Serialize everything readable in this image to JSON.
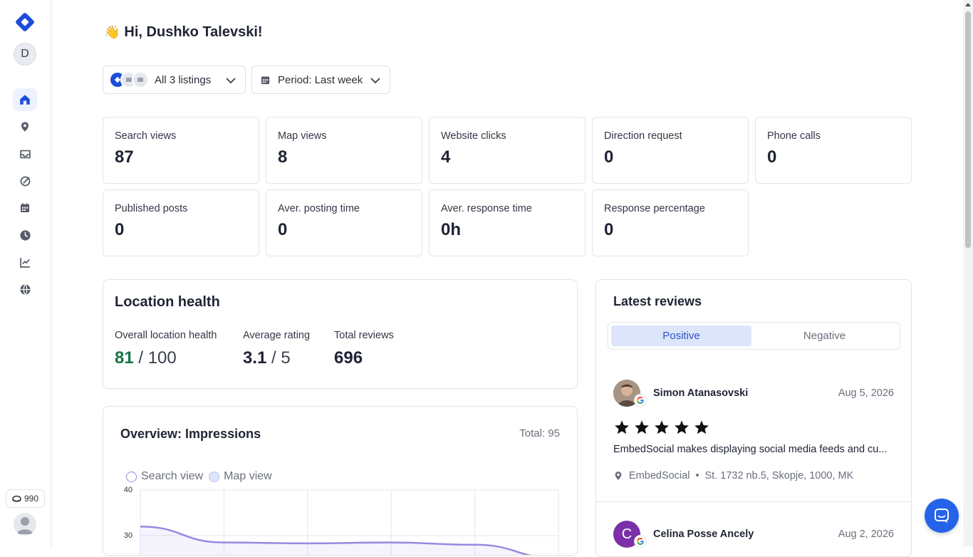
{
  "sidebar": {
    "avatar_initial": "D",
    "credits": "990",
    "items": [
      {
        "icon": "home-icon",
        "active": true
      },
      {
        "icon": "location-pin-icon",
        "active": false
      },
      {
        "icon": "inbox-icon",
        "active": false
      },
      {
        "icon": "posts-icon",
        "active": false
      },
      {
        "icon": "calendar-icon",
        "active": false
      },
      {
        "icon": "clock-icon",
        "active": false
      },
      {
        "icon": "analytics-icon",
        "active": false
      },
      {
        "icon": "globe-icon",
        "active": false
      }
    ]
  },
  "header": {
    "wave": "👋",
    "greeting": "Hi, Dushko Talevski!"
  },
  "filters": {
    "listings": "All 3 listings",
    "period": "Period: Last week"
  },
  "stats": [
    {
      "label": "Search views",
      "value": "87"
    },
    {
      "label": "Map views",
      "value": "8"
    },
    {
      "label": "Website clicks",
      "value": "4"
    },
    {
      "label": "Direction request",
      "value": "0"
    },
    {
      "label": "Phone calls",
      "value": "0"
    },
    {
      "label": "Published posts",
      "value": "0"
    },
    {
      "label": "Aver. posting time",
      "value": "0"
    },
    {
      "label": "Aver. response time",
      "value": "0h"
    },
    {
      "label": "Response percentage",
      "value": "0"
    }
  ],
  "health": {
    "title": "Location health",
    "overall_label": "Overall location health",
    "overall_value": "81",
    "overall_max": "/ 100",
    "rating_label": "Average rating",
    "rating_value": "3.1",
    "rating_max": "/ 5",
    "reviews_label": "Total reviews",
    "reviews_value": "696"
  },
  "overview": {
    "title": "Overview: Impressions",
    "total": "Total: 95",
    "legend": [
      "Search view",
      "Map view"
    ],
    "colors": {
      "search": "#9b87e0",
      "map": "#b7c4f2"
    }
  },
  "chart_data": {
    "type": "line",
    "series": [
      {
        "name": "Search view",
        "values": [
          32,
          28.5,
          28.3,
          28.5,
          28,
          25
        ]
      },
      {
        "name": "Map view",
        "values": []
      }
    ],
    "y_ticks": [
      "40",
      "30"
    ],
    "ylim": [
      0,
      40
    ]
  },
  "reviews": {
    "title": "Latest reviews",
    "tab_positive": "Positive",
    "tab_negative": "Negative",
    "items": [
      {
        "name": "Simon Atanasovski",
        "date": "Aug 5, 2026",
        "stars": 5,
        "text": "EmbedSocial makes displaying social media feeds and cu...",
        "business": "EmbedSocial",
        "address": "St. 1732 nb.5, Skopje, 1000, MK"
      },
      {
        "name": "Celina Posse Ancely",
        "date": "Aug 2, 2026",
        "initial": "C"
      }
    ]
  },
  "brand_color": "#1d4ed8"
}
